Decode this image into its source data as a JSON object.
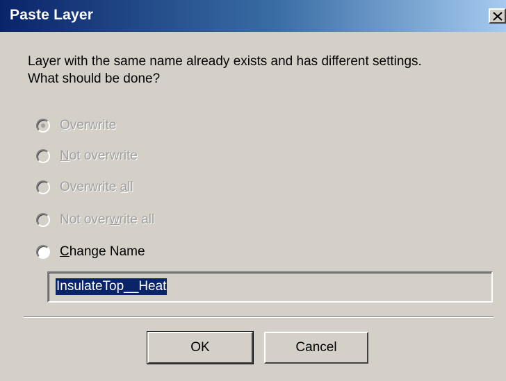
{
  "window": {
    "title": "Paste Layer"
  },
  "message": "Layer with the same name already exists and has different settings.\nWhat should be done?",
  "options": [
    {
      "prefix": "",
      "accel": "O",
      "suffix": "verwrite",
      "checked": true,
      "enabled": false
    },
    {
      "prefix": "",
      "accel": "N",
      "suffix": "ot overwrite",
      "checked": false,
      "enabled": false
    },
    {
      "prefix": "Overwrite ",
      "accel": "a",
      "suffix": "ll",
      "checked": false,
      "enabled": false
    },
    {
      "prefix": "Not over",
      "accel": "w",
      "suffix": "rite all",
      "checked": false,
      "enabled": false
    },
    {
      "prefix": "",
      "accel": "C",
      "suffix": "hange Name",
      "checked": false,
      "enabled": true
    }
  ],
  "name_input": {
    "value": "InsulateTop__Heat"
  },
  "buttons": {
    "ok": "OK",
    "cancel": "Cancel"
  },
  "colors": {
    "titlebar_start": "#0a246a",
    "titlebar_end": "#a6caf0",
    "dialog_bg": "#d4d0c8",
    "selection": "#0a246a",
    "disabled_text": "#a0a0a0"
  },
  "icons": {
    "close": "close-icon"
  }
}
